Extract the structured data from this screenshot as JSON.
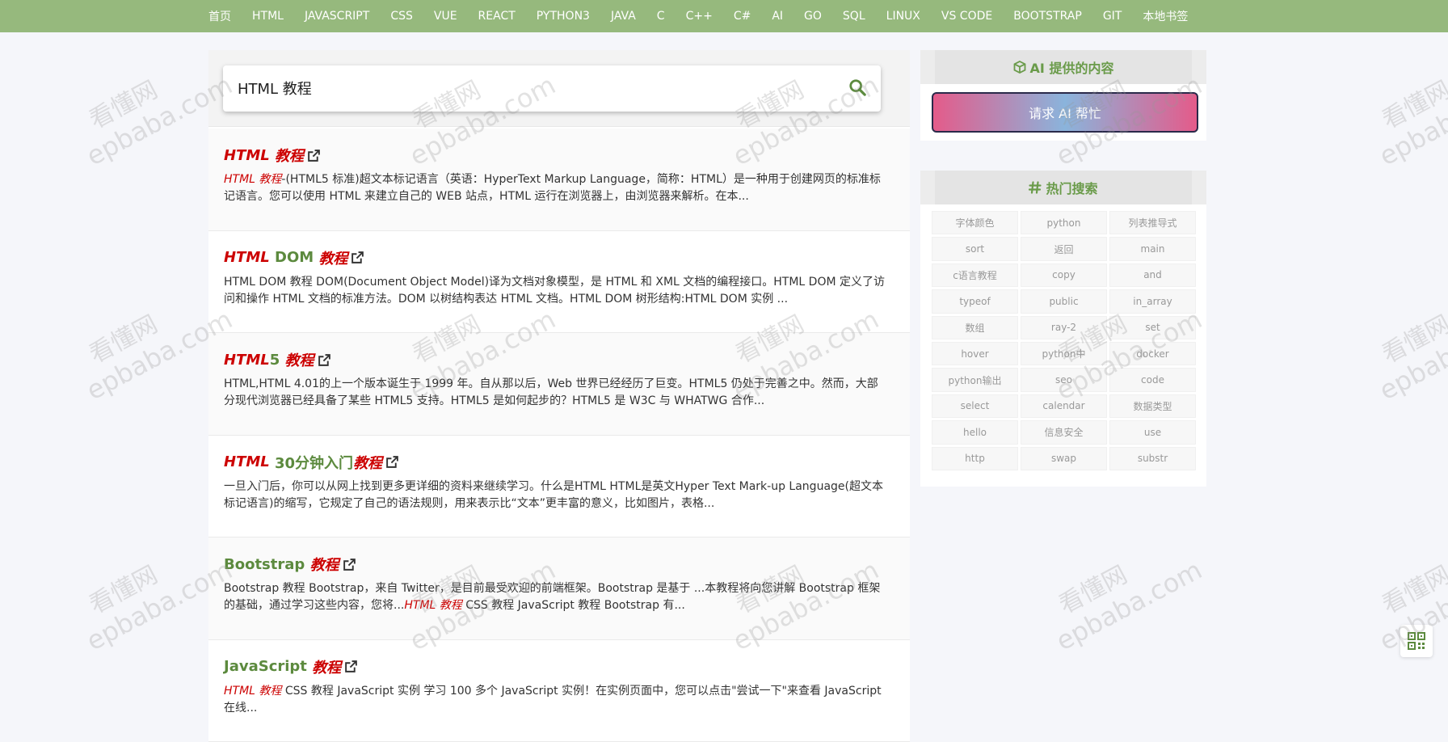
{
  "nav": {
    "items": [
      "首页",
      "HTML",
      "JAVASCRIPT",
      "CSS",
      "VUE",
      "REACT",
      "PYTHON3",
      "JAVA",
      "C",
      "C++",
      "C#",
      "AI",
      "GO",
      "SQL",
      "LINUX",
      "VS CODE",
      "BOOTSTRAP",
      "GIT",
      "本地书签"
    ]
  },
  "search": {
    "value": "HTML 教程"
  },
  "results": [
    {
      "title": [
        {
          "t": "HTML",
          "hl": true
        },
        {
          "t": " ",
          "hl": false
        },
        {
          "t": "教程",
          "hl": true
        }
      ],
      "desc": [
        {
          "t": "HTML 教程",
          "hl": true
        },
        {
          "t": "-(HTML5 标准)超文本标记语言（英语：HyperText Markup Language，简称：HTML）是一种用于创建网页的标准标记语言。您可以使用 HTML 来建立自己的 WEB 站点，HTML 运行在浏览器上，由浏览器来解析。在本...",
          "hl": false
        }
      ]
    },
    {
      "title": [
        {
          "t": "HTML",
          "hl": true
        },
        {
          "t": " DOM ",
          "hl": false
        },
        {
          "t": "教程",
          "hl": true
        }
      ],
      "desc": [
        {
          "t": "HTML DOM 教程 DOM(Document Object Model)译为文档对象模型，是 HTML 和 XML 文档的编程接口。HTML DOM 定义了访问和操作 HTML 文档的标准方法。DOM 以树结构表达 HTML 文档。HTML DOM 树形结构:HTML DOM 实例 ...",
          "hl": false
        }
      ]
    },
    {
      "title": [
        {
          "t": "HTML",
          "hl": true
        },
        {
          "t": "5 ",
          "hl": false
        },
        {
          "t": "教程",
          "hl": true
        }
      ],
      "desc": [
        {
          "t": "HTML,HTML 4.01的上一个版本诞生于 1999 年。自从那以后，Web 世界已经经历了巨变。HTML5 仍处于完善之中。然而，大部分现代浏览器已经具备了某些 HTML5 支持。HTML5 是如何起步的？HTML5 是 W3C 与 WHATWG 合作...",
          "hl": false
        }
      ]
    },
    {
      "title": [
        {
          "t": "HTML",
          "hl": true
        },
        {
          "t": " 30分钟入门",
          "hl": false
        },
        {
          "t": "教程",
          "hl": true
        }
      ],
      "desc": [
        {
          "t": "一旦入门后，你可以从网上找到更多更详细的资料来继续学习。什么是HTML HTML是英文Hyper Text Mark-up Language(超文本标记语言)的缩写，它规定了自己的语法规则，用来表示比“文本”更丰富的意义，比如图片，表格...",
          "hl": false
        }
      ]
    },
    {
      "title": [
        {
          "t": "Bootstrap ",
          "hl": false
        },
        {
          "t": "教程",
          "hl": true
        }
      ],
      "desc": [
        {
          "t": "Bootstrap 教程 Bootstrap，来自 Twitter，是目前最受欢迎的前端框架。Bootstrap 是基于 ...本教程将向您讲解 Bootstrap 框架的基础，通过学习这些内容，您将...",
          "hl": false
        },
        {
          "t": "HTML 教程",
          "hl": true
        },
        {
          "t": " CSS 教程 JavaScript 教程 Bootstrap 有...",
          "hl": false
        }
      ]
    },
    {
      "title": [
        {
          "t": "JavaScript ",
          "hl": false
        },
        {
          "t": "教程",
          "hl": true
        }
      ],
      "desc": [
        {
          "t": "HTML 教程",
          "hl": true
        },
        {
          "t": " CSS 教程 JavaScript 实例 学习 100 多个 JavaScript 实例！在实例页面中，您可以点击\"尝试一下\"来查看 JavaScript 在线...",
          "hl": false
        }
      ]
    }
  ],
  "sidebar": {
    "ai_title": "AI 提供的内容",
    "ai_button": "请求 AI 帮忙",
    "hot_title": "热门搜索",
    "hot_items": [
      "字体颜色",
      "python",
      "列表推导式",
      "sort",
      "返回",
      "main",
      "c语言教程",
      "copy",
      "and",
      "typeof",
      "public",
      "in_array",
      "数组",
      "ray-2",
      "set",
      "hover",
      "python中",
      "docker",
      "python输出",
      "seo",
      "code",
      "select",
      "calendar",
      "数据类型",
      "hello",
      "信息安全",
      "use",
      "http",
      "swap",
      "substr"
    ]
  },
  "watermark": {
    "line1": "看懂网",
    "line2": "epbaba.com"
  },
  "colors": {
    "nav_bg": "#96b97d",
    "accent_green": "#5c8a3e",
    "highlight_red": "#cc0000"
  },
  "icons": [
    "search-icon",
    "external-link-icon",
    "cube-icon",
    "hashtag-icon",
    "qrcode-icon"
  ]
}
